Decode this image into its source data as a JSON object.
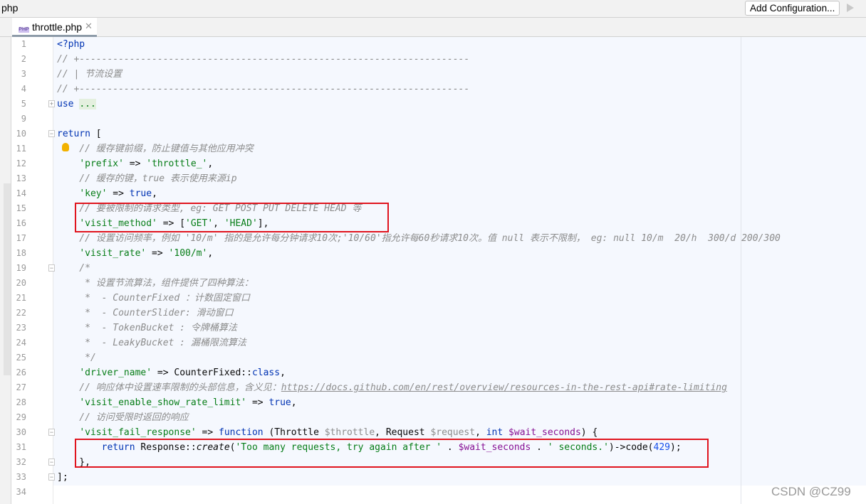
{
  "window": {
    "project": "php",
    "add_configuration": "Add Configuration..."
  },
  "tab": {
    "label": "throttle.php",
    "icon": "php-file-icon"
  },
  "watermark": "CSDN @CZ99",
  "colors": {
    "keyword": "#0033b3",
    "string": "#067d17",
    "comment": "#8c8c8c",
    "variable": "#871094",
    "number": "#1750eb",
    "highlight_box": "#e0141e"
  },
  "lines": [
    {
      "n": "1",
      "t": [
        [
          "kw",
          "<?php"
        ]
      ]
    },
    {
      "n": "2",
      "t": [
        [
          "cm",
          "// +----------------------------------------------------------------------"
        ]
      ]
    },
    {
      "n": "3",
      "t": [
        [
          "cm",
          "// | 节流设置"
        ]
      ]
    },
    {
      "n": "4",
      "t": [
        [
          "cm",
          "// +----------------------------------------------------------------------"
        ]
      ]
    },
    {
      "n": "5",
      "fold": "+",
      "t": [
        [
          "kw",
          "use"
        ],
        [
          "pl",
          " "
        ],
        [
          "fold-txt",
          "..."
        ]
      ]
    },
    {
      "n": "9",
      "t": []
    },
    {
      "n": "10",
      "fold": "-",
      "t": [
        [
          "kw",
          "return"
        ],
        [
          "pl",
          " ["
        ]
      ]
    },
    {
      "n": "11",
      "bulb": true,
      "t": [
        [
          "cm",
          "    // 缓存键前缀，防止键值与其他应用冲突"
        ]
      ]
    },
    {
      "n": "12",
      "t": [
        [
          "pl",
          "    "
        ],
        [
          "str",
          "'prefix'"
        ],
        [
          "pl",
          " => "
        ],
        [
          "str",
          "'throttle_'"
        ],
        [
          "pl",
          ","
        ]
      ]
    },
    {
      "n": "13",
      "t": [
        [
          "cm",
          "    // 缓存的键，true 表示使用来源ip"
        ]
      ]
    },
    {
      "n": "14",
      "t": [
        [
          "pl",
          "    "
        ],
        [
          "str",
          "'key'"
        ],
        [
          "pl",
          " => "
        ],
        [
          "kw",
          "true"
        ],
        [
          "pl",
          ","
        ]
      ]
    },
    {
      "n": "15",
      "t": [
        [
          "cm",
          "    // 要被限制的请求类型, eg: GET POST PUT DELETE HEAD 等"
        ]
      ]
    },
    {
      "n": "16",
      "t": [
        [
          "pl",
          "    "
        ],
        [
          "str",
          "'visit_method'"
        ],
        [
          "pl",
          " => ["
        ],
        [
          "str",
          "'GET'"
        ],
        [
          "pl",
          ", "
        ],
        [
          "str",
          "'HEAD'"
        ],
        [
          "pl",
          "],"
        ]
      ]
    },
    {
      "n": "17",
      "t": [
        [
          "cm",
          "    // 设置访问频率，例如 '10/m' 指的是允许每分钟请求10次;'10/60'指允许每60秒请求10次。值 null 表示不限制， eg: null 10/m  20/h  300/d 200/300"
        ]
      ]
    },
    {
      "n": "18",
      "t": [
        [
          "pl",
          "    "
        ],
        [
          "str",
          "'visit_rate'"
        ],
        [
          "pl",
          " => "
        ],
        [
          "str",
          "'100/m'"
        ],
        [
          "pl",
          ","
        ]
      ]
    },
    {
      "n": "19",
      "fold": "-",
      "t": [
        [
          "cm",
          "    /*"
        ]
      ]
    },
    {
      "n": "20",
      "t": [
        [
          "cm",
          "     * 设置节流算法，组件提供了四种算法："
        ]
      ]
    },
    {
      "n": "21",
      "t": [
        [
          "cm",
          "     *  - CounterFixed ：计数固定窗口"
        ]
      ]
    },
    {
      "n": "22",
      "t": [
        [
          "cm",
          "     *  - CounterSlider: 滑动窗口"
        ]
      ]
    },
    {
      "n": "23",
      "t": [
        [
          "cm",
          "     *  - TokenBucket : 令牌桶算法"
        ]
      ]
    },
    {
      "n": "24",
      "t": [
        [
          "cm",
          "     *  - LeakyBucket : 漏桶限流算法"
        ]
      ]
    },
    {
      "n": "25",
      "t": [
        [
          "cm",
          "     */"
        ]
      ]
    },
    {
      "n": "26",
      "t": [
        [
          "pl",
          "    "
        ],
        [
          "str",
          "'driver_name'"
        ],
        [
          "pl",
          " => CounterFixed::"
        ],
        [
          "kw",
          "class"
        ],
        [
          "pl",
          ","
        ]
      ]
    },
    {
      "n": "27",
      "t": [
        [
          "cm",
          "    // 响应体中设置速率限制的头部信息，含义见："
        ],
        [
          "link",
          "https://docs.github.com/en/rest/overview/resources-in-the-rest-api#rate-limiting"
        ]
      ]
    },
    {
      "n": "28",
      "t": [
        [
          "pl",
          "    "
        ],
        [
          "str",
          "'visit_enable_show_rate_limit'"
        ],
        [
          "pl",
          " => "
        ],
        [
          "kw",
          "true"
        ],
        [
          "pl",
          ","
        ]
      ]
    },
    {
      "n": "29",
      "t": [
        [
          "cm",
          "    // 访问受限时返回的响应"
        ]
      ]
    },
    {
      "n": "30",
      "fold": "-",
      "t": [
        [
          "pl",
          "    "
        ],
        [
          "str",
          "'visit_fail_response'"
        ],
        [
          "pl",
          " => "
        ],
        [
          "kw",
          "function"
        ],
        [
          "pl",
          " (Throttle "
        ],
        [
          "uvar",
          "$throttle"
        ],
        [
          "pl",
          ", Request "
        ],
        [
          "uvar",
          "$request"
        ],
        [
          "pl",
          ", "
        ],
        [
          "kw",
          "int"
        ],
        [
          "pl",
          " "
        ],
        [
          "var",
          "$wait_seconds"
        ],
        [
          "pl",
          ") {"
        ]
      ]
    },
    {
      "n": "31",
      "t": [
        [
          "pl",
          "        "
        ],
        [
          "kw",
          "return"
        ],
        [
          "pl",
          " Response::"
        ],
        [
          "it",
          "create"
        ],
        [
          "pl",
          "("
        ],
        [
          "str",
          "'Too many requests, try again after '"
        ],
        [
          "pl",
          " . "
        ],
        [
          "var",
          "$wait_seconds"
        ],
        [
          "pl",
          " . "
        ],
        [
          "str",
          "' seconds.'"
        ],
        [
          "pl",
          ")->code("
        ],
        [
          "num",
          "429"
        ],
        [
          "pl",
          ");"
        ]
      ]
    },
    {
      "n": "32",
      "fold": "-",
      "t": [
        [
          "pl",
          "    },"
        ]
      ]
    },
    {
      "n": "33",
      "fold": "-",
      "t": [
        [
          "pl",
          "];"
        ]
      ]
    },
    {
      "n": "34",
      "t": []
    }
  ]
}
